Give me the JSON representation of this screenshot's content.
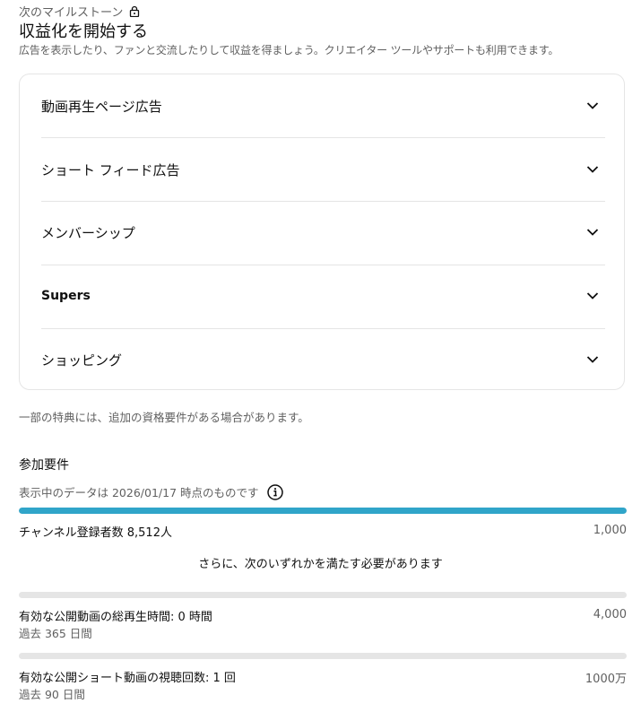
{
  "header": {
    "milestone_label": "次のマイルストーン",
    "title": "収益化を開始する",
    "subtitle": "広告を表示したり、ファンと交流したりして収益を得ましょう。クリエイター ツールやサポートも利用できます。"
  },
  "accordion": {
    "items": [
      {
        "label": "動画再生ページ広告"
      },
      {
        "label": "ショート フィード広告"
      },
      {
        "label": "メンバーシップ"
      },
      {
        "label": "Supers"
      },
      {
        "label": "ショッピング"
      }
    ]
  },
  "note": "一部の特典には、追加の資格要件がある場合があります。",
  "requirements": {
    "title": "参加要件",
    "data_timestamp": "表示中のデータは 2026/01/17 時点のものです",
    "subscribers": {
      "label": "チャンネル登録者数 8,512人",
      "target": "1,000",
      "progress": 1.0
    },
    "additional": "さらに、次のいずれかを満たす必要があります",
    "watch_hours": {
      "label": "有効な公開動画の総再生時間: 0 時間",
      "period": "過去 365 日間",
      "target": "4,000",
      "progress": 0.0
    },
    "shorts_views": {
      "label": "有効な公開ショート動画の視聴回数: 1 回",
      "period": "過去 90 日間",
      "target": "1000万",
      "progress": 0.0
    }
  },
  "colors": {
    "progress_fill": "#30a5c9",
    "track": "#e5e5e5",
    "secondary_text": "#606060"
  }
}
